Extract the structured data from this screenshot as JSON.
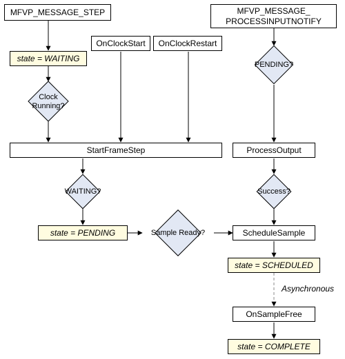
{
  "header": {
    "msg_step": "MFVP_MESSAGE_STEP",
    "msg_notify": "MFVP_MESSAGE_\nPROCESSINPUTNOTIFY",
    "on_clock_start": "OnClockStart",
    "on_clock_restart": "OnClockRestart"
  },
  "states": {
    "waiting": "state = WAITING",
    "pending": "state = PENDING",
    "scheduled": "state = SCHEDULED",
    "complete": "state = COMPLETE"
  },
  "process": {
    "start_frame_step": "StartFrameStep",
    "process_output": "ProcessOutput",
    "schedule_sample": "ScheduleSample",
    "on_sample_free": "OnSampleFree"
  },
  "decisions": {
    "clock_running": "Clock\nRunning?",
    "pending": "PENDING?",
    "waiting_q": "WAITING?",
    "success": "Success?",
    "sample_ready": "Sample Ready?"
  },
  "annotations": {
    "asynchronous": "Asynchronous"
  },
  "chart_data": {
    "type": "flowchart",
    "nodes": [
      {
        "id": "msg_step",
        "type": "terminator",
        "label": "MFVP_MESSAGE_STEP"
      },
      {
        "id": "msg_notify",
        "type": "terminator",
        "label": "MFVP_MESSAGE_PROCESSINPUTNOTIFY"
      },
      {
        "id": "on_clock_start",
        "type": "terminator",
        "label": "OnClockStart"
      },
      {
        "id": "on_clock_restart",
        "type": "terminator",
        "label": "OnClockRestart"
      },
      {
        "id": "state_waiting",
        "type": "state",
        "label": "state = WAITING"
      },
      {
        "id": "clock_running",
        "type": "decision",
        "label": "Clock Running?"
      },
      {
        "id": "start_frame_step",
        "type": "process",
        "label": "StartFrameStep"
      },
      {
        "id": "waiting_q",
        "type": "decision",
        "label": "WAITING?"
      },
      {
        "id": "state_pending",
        "type": "state",
        "label": "state = PENDING"
      },
      {
        "id": "sample_ready",
        "type": "decision",
        "label": "Sample Ready?"
      },
      {
        "id": "pending_q",
        "type": "decision",
        "label": "PENDING?"
      },
      {
        "id": "process_output",
        "type": "process",
        "label": "ProcessOutput"
      },
      {
        "id": "success_q",
        "type": "decision",
        "label": "Success?"
      },
      {
        "id": "schedule_sample",
        "type": "process",
        "label": "ScheduleSample"
      },
      {
        "id": "state_scheduled",
        "type": "state",
        "label": "state = SCHEDULED"
      },
      {
        "id": "on_sample_free",
        "type": "process",
        "label": "OnSampleFree"
      },
      {
        "id": "state_complete",
        "type": "state",
        "label": "state = COMPLETE"
      }
    ],
    "edges": [
      {
        "from": "msg_step",
        "to": "state_waiting"
      },
      {
        "from": "state_waiting",
        "to": "clock_running"
      },
      {
        "from": "clock_running",
        "to": "start_frame_step"
      },
      {
        "from": "on_clock_start",
        "to": "start_frame_step"
      },
      {
        "from": "on_clock_restart",
        "to": "start_frame_step"
      },
      {
        "from": "start_frame_step",
        "to": "waiting_q"
      },
      {
        "from": "waiting_q",
        "to": "state_pending"
      },
      {
        "from": "state_pending",
        "to": "sample_ready"
      },
      {
        "from": "sample_ready",
        "to": "schedule_sample"
      },
      {
        "from": "msg_notify",
        "to": "pending_q"
      },
      {
        "from": "pending_q",
        "to": "process_output"
      },
      {
        "from": "process_output",
        "to": "success_q"
      },
      {
        "from": "success_q",
        "to": "schedule_sample"
      },
      {
        "from": "schedule_sample",
        "to": "state_scheduled"
      },
      {
        "from": "state_scheduled",
        "to": "on_sample_free",
        "style": "dashed",
        "label": "Asynchronous"
      },
      {
        "from": "on_sample_free",
        "to": "state_complete"
      }
    ]
  }
}
